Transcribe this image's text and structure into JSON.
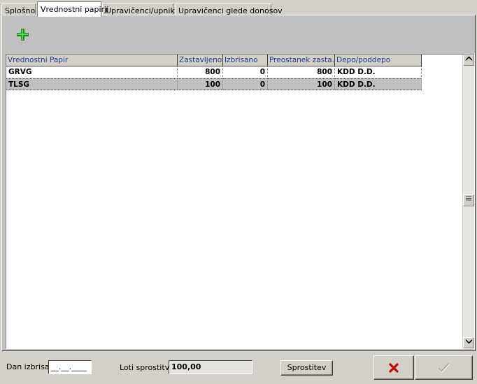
{
  "tabs": [
    {
      "label": "Splošno"
    },
    {
      "label": "Vrednostni papirji"
    },
    {
      "label": "Upravičenci/upniki"
    },
    {
      "label": "Upravičenci glede donosov"
    }
  ],
  "active_tab": 1,
  "toolbar": {
    "add_icon": "plus-icon",
    "add_color": "#1e8c1e"
  },
  "grid": {
    "columns": [
      "Vrednostni Papir",
      "Zastavljeno",
      "Izbrisano",
      "Preostanek zasta...",
      "Depo/poddepo"
    ],
    "rows": [
      {
        "papir": "GRVG",
        "zastavljeno": "800",
        "izbrisano": "0",
        "preostanek": "800",
        "depo": "KDD D.D."
      },
      {
        "papir": "TLSG",
        "zastavljeno": "100",
        "izbrisano": "0",
        "preostanek": "100",
        "depo": "KDD D.D."
      }
    ],
    "selected_row": 1
  },
  "bottom": {
    "dan_izbrisa_label": "Dan izbrisa",
    "dan_izbrisa_value": "__.__.____",
    "loti_label": "Loti sprostitve",
    "loti_value": "100,00",
    "sprostitev_label": "Sprostitev",
    "cancel_icon": "x-icon",
    "cancel_color": "#c00000",
    "confirm_icon": "check-icon"
  }
}
